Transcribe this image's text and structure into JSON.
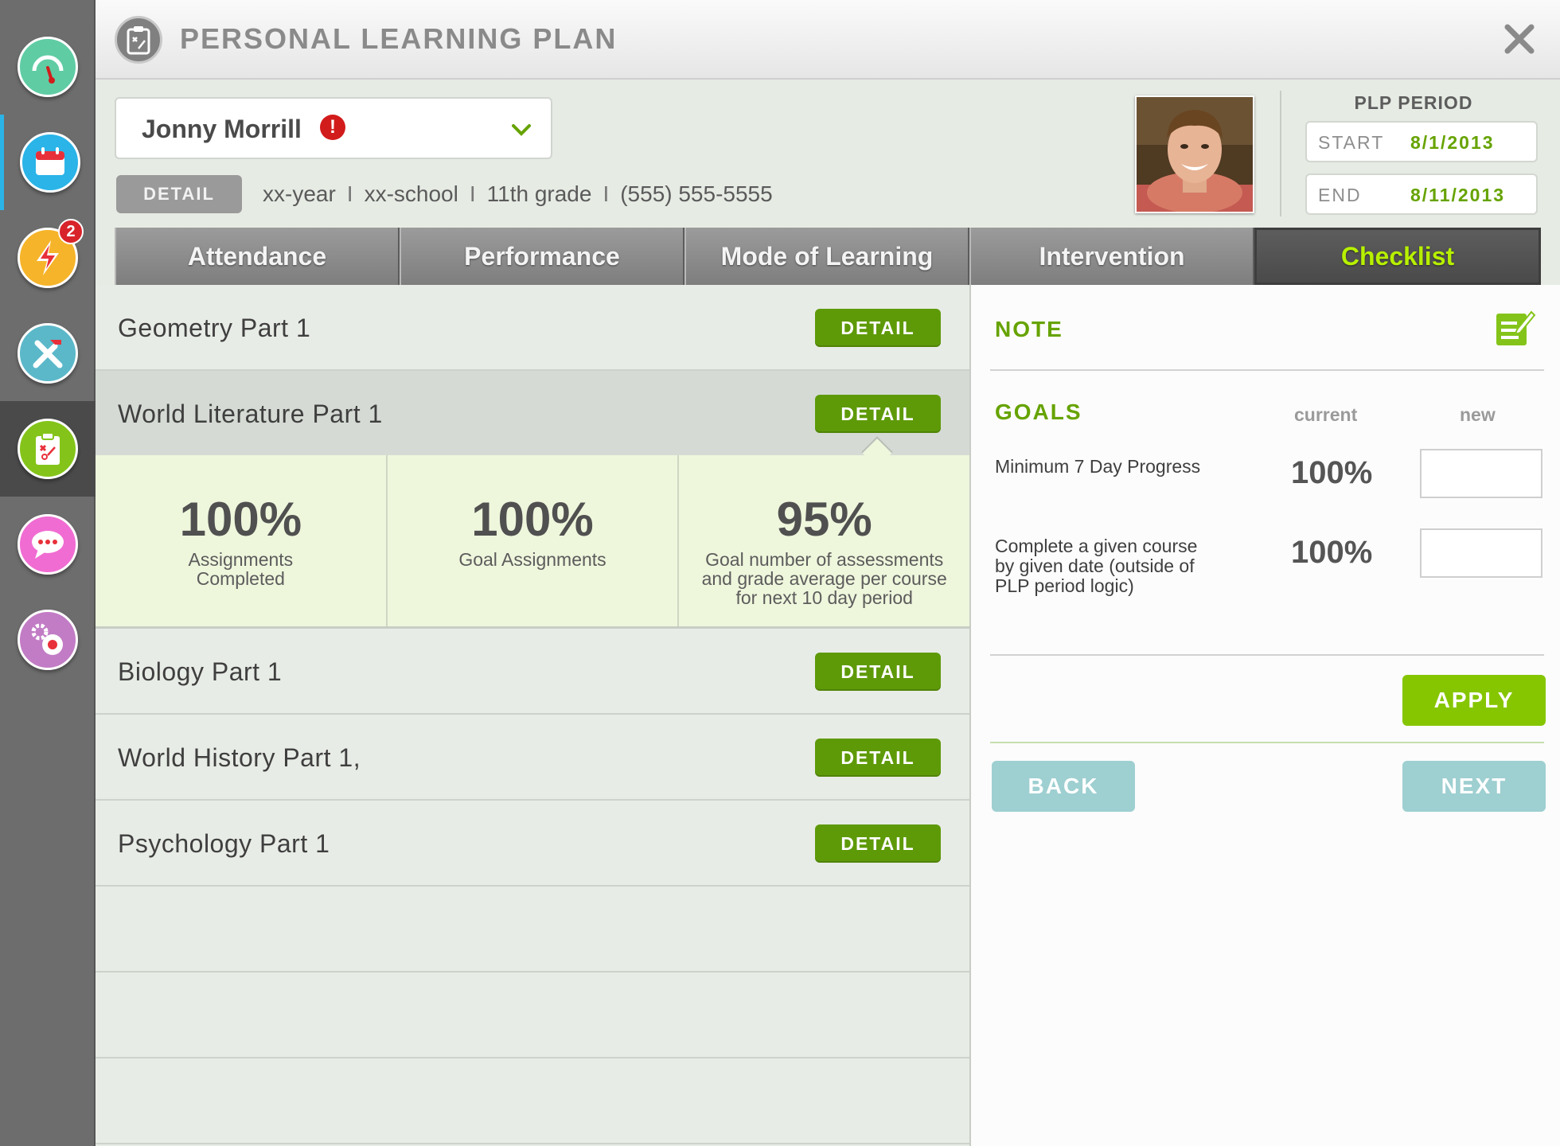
{
  "sidebar": {
    "items": [
      {
        "icon": "gauge-icon",
        "color": "#5fcca4"
      },
      {
        "icon": "calendar-icon",
        "color": "#2ab4e8"
      },
      {
        "icon": "lightning-icon",
        "color": "#f6b42a",
        "badge": "2"
      },
      {
        "icon": "tools-icon",
        "color": "#5bb8c9"
      },
      {
        "icon": "clipboard-icon",
        "color": "#84c41a"
      },
      {
        "icon": "chat-icon",
        "color": "#f06cd2"
      },
      {
        "icon": "gears-icon",
        "color": "#c27cc5"
      }
    ]
  },
  "header": {
    "title": "PERSONAL LEARNING PLAN"
  },
  "student": {
    "name": "Jonny Morrill",
    "alert": "!",
    "detail_label": "DETAIL",
    "year": "xx-year",
    "school": "xx-school",
    "grade": "11th grade",
    "phone": "(555) 555-5555",
    "separator": "I"
  },
  "plp_period": {
    "label": "PLP PERIOD",
    "start_label": "START",
    "start_value": "8/1/2013",
    "end_label": "END",
    "end_value": "8/11/2013"
  },
  "tabs": [
    {
      "label": "Attendance"
    },
    {
      "label": "Performance"
    },
    {
      "label": "Mode of Learning"
    },
    {
      "label": "Intervention"
    },
    {
      "label": "Checklist",
      "active": true
    }
  ],
  "courses": [
    {
      "name": "Geometry Part 1",
      "button": "DETAIL"
    },
    {
      "name": "World Literature Part 1",
      "button": "DETAIL",
      "selected": true
    },
    {
      "name": "Biology Part 1",
      "button": "DETAIL"
    },
    {
      "name": "World History Part 1,",
      "button": "DETAIL"
    },
    {
      "name": "Psychology Part 1",
      "button": "DETAIL"
    }
  ],
  "course_stats": [
    {
      "value": "100%",
      "label": "Assignments Completed"
    },
    {
      "value": "100%",
      "label": "Goal Assignments"
    },
    {
      "value": "95%",
      "label": "Goal number of assessments and grade average per course for next 10 day period"
    }
  ],
  "checklist": {
    "note_title": "NOTE",
    "goals_title": "GOALS",
    "col_current": "current",
    "col_new": "new",
    "goals": [
      {
        "label": "Minimum 7 Day Progress",
        "current": "100%",
        "new": ""
      },
      {
        "label": "Complete a given course by given date (outside of PLP period logic)",
        "current": "100%",
        "new": ""
      }
    ],
    "apply_label": "APPLY",
    "back_label": "BACK",
    "next_label": "NEXT"
  },
  "colors": {
    "accent_green": "#66a300",
    "button_green": "#5e9a08",
    "apply_green": "#86c600",
    "nav_teal": "#9ecfd1",
    "active_tab_text": "#b7f000"
  }
}
